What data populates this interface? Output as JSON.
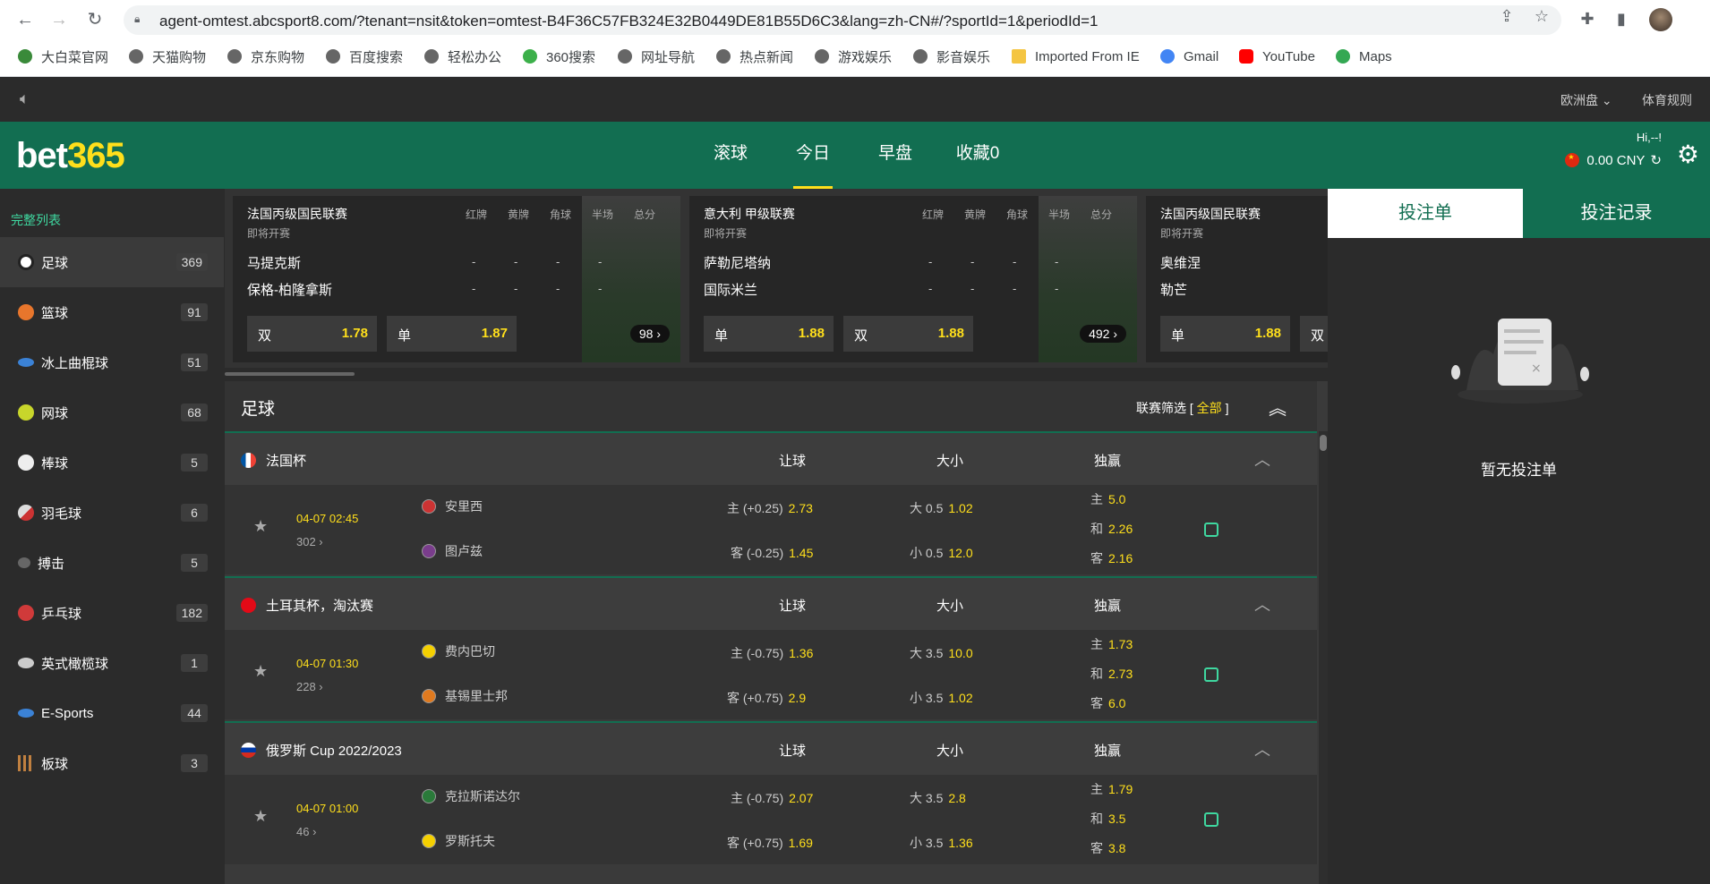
{
  "browser": {
    "url": "agent-omtest.abcsport8.com/?tenant=nsit&token=omtest-B4F36C57FB324E32B0449DE81B55D6C3&lang=zh-CN#/?sportId=1&periodId=1",
    "bookmarks": [
      "大白菜官网",
      "天猫购物",
      "京东购物",
      "百度搜索",
      "轻松办公",
      "360搜索",
      "网址导航",
      "热点新闻",
      "游戏娱乐",
      "影音娱乐",
      "Imported From IE",
      "Gmail",
      "YouTube",
      "Maps"
    ]
  },
  "topbar": {
    "odds_format": "欧洲盘 ⌄",
    "rules": "体育规则"
  },
  "header": {
    "logo_main": "bet",
    "logo_accent": "365",
    "tabs": [
      "滚球",
      "今日",
      "早盘",
      "收藏0"
    ],
    "active_tab": "今日",
    "greeting": "Hi,--!",
    "balance": "0.00 CNY"
  },
  "sidebar": {
    "full_list": "完整列表",
    "items": [
      {
        "label": "足球",
        "count": "369",
        "color": "#ffffff"
      },
      {
        "label": "篮球",
        "count": "91",
        "color": "#e8762c"
      },
      {
        "label": "冰上曲棍球",
        "count": "51",
        "color": "#3b82d6"
      },
      {
        "label": "网球",
        "count": "68",
        "color": "#c8d62b"
      },
      {
        "label": "棒球",
        "count": "5",
        "color": "#eeeeee"
      },
      {
        "label": "羽毛球",
        "count": "6",
        "color": "#dddddd"
      },
      {
        "label": "搏击",
        "count": "5",
        "color": "#777777"
      },
      {
        "label": "乒乓球",
        "count": "182",
        "color": "#d03a3a"
      },
      {
        "label": "英式橄榄球",
        "count": "1",
        "color": "#cccccc"
      },
      {
        "label": "E-Sports",
        "count": "44",
        "color": "#3b82d6"
      },
      {
        "label": "板球",
        "count": "3",
        "color": "#c08040"
      }
    ]
  },
  "carousel": {
    "col_headers": [
      "红牌",
      "黄牌",
      "角球",
      "半场",
      "总分"
    ],
    "cards": [
      {
        "league": "法国丙级国民联赛",
        "status": "即将开赛",
        "home": "马提克斯",
        "away": "保格-柏隆拿斯",
        "bet1_label": "双",
        "bet1_odds": "1.78",
        "bet2_label": "单",
        "bet2_odds": "1.87",
        "more": "98 ›"
      },
      {
        "league": "意大利 甲级联赛",
        "status": "即将开赛",
        "home": "萨勒尼塔纳",
        "away": "国际米兰",
        "bet1_label": "单",
        "bet1_odds": "1.88",
        "bet2_label": "双",
        "bet2_odds": "1.88",
        "more": "492 ›"
      },
      {
        "league": "法国丙级国民联赛",
        "status": "即将开赛",
        "home": "奥维涅",
        "away": "勒芒",
        "bet1_label": "单",
        "bet1_odds": "1.88",
        "bet2_label": "双",
        "bet2_odds": ""
      }
    ]
  },
  "main": {
    "title": "足球",
    "filter_label": "联赛筛选 [",
    "filter_value": "全部",
    "filter_close": "]",
    "col_headers": [
      "让球",
      "大小",
      "独赢"
    ],
    "competitions": [
      {
        "name": "法国杯",
        "match": {
          "time": "04-07 02:45",
          "count": "302 ›",
          "home": "安里西",
          "away": "图卢兹",
          "hdp_home": "主 (+0.25)",
          "hdp_home_odds": "2.73",
          "hdp_away": "客 (-0.25)",
          "hdp_away_odds": "1.45",
          "ou_over": "大 0.5",
          "ou_over_odds": "1.02",
          "ou_under": "小 0.5",
          "ou_under_odds": "12.0",
          "ml_home": "主",
          "ml_home_odds": "5.0",
          "ml_draw": "和",
          "ml_draw_odds": "2.26",
          "ml_away": "客",
          "ml_away_odds": "2.16"
        }
      },
      {
        "name": "土耳其杯，淘汰赛",
        "match": {
          "time": "04-07 01:30",
          "count": "228 ›",
          "home": "费内巴切",
          "away": "基锡里士邦",
          "hdp_home": "主 (-0.75)",
          "hdp_home_odds": "1.36",
          "hdp_away": "客 (+0.75)",
          "hdp_away_odds": "2.9",
          "ou_over": "大 3.5",
          "ou_over_odds": "10.0",
          "ou_under": "小 3.5",
          "ou_under_odds": "1.02",
          "ml_home": "主",
          "ml_home_odds": "1.73",
          "ml_draw": "和",
          "ml_draw_odds": "2.73",
          "ml_away": "客",
          "ml_away_odds": "6.0"
        }
      },
      {
        "name": "俄罗斯 Cup 2022/2023",
        "match": {
          "time": "04-07 01:00",
          "count": "46 ›",
          "home": "克拉斯诺达尔",
          "away": "罗斯托夫",
          "hdp_home": "主 (-0.75)",
          "hdp_home_odds": "2.07",
          "hdp_away": "客 (+0.75)",
          "hdp_away_odds": "1.69",
          "ou_over": "大 3.5",
          "ou_over_odds": "2.8",
          "ou_under": "小 3.5",
          "ou_under_odds": "1.36",
          "ml_home": "主",
          "ml_home_odds": "1.79",
          "ml_draw": "和",
          "ml_draw_odds": "3.5",
          "ml_away": "客",
          "ml_away_odds": "3.8"
        }
      }
    ]
  },
  "betslip": {
    "tab_slip": "投注单",
    "tab_history": "投注记录",
    "empty_text": "暂无投注单"
  }
}
